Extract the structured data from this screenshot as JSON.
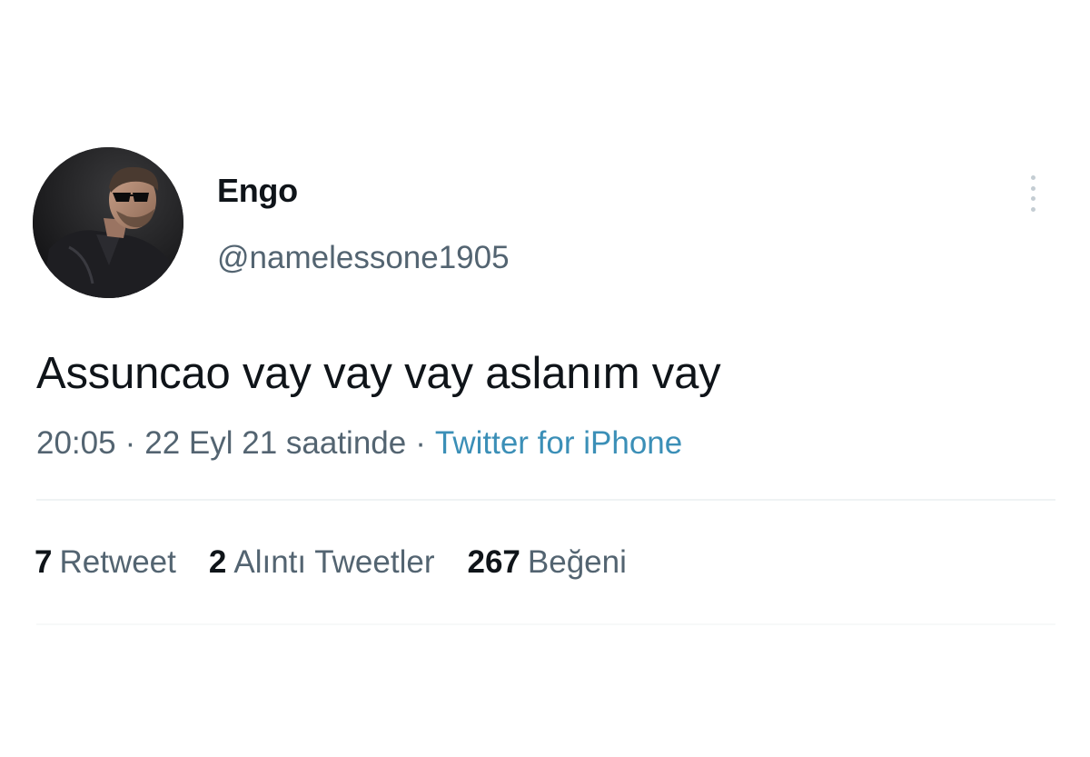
{
  "author": {
    "display_name": "Engo",
    "handle": "@namelessone1905"
  },
  "tweet": {
    "text": "Assuncao vay vay vay aslanım vay",
    "time": "20:05",
    "date": "22 Eyl 21 saatinde",
    "separator": "·",
    "source": "Twitter for iPhone"
  },
  "stats": {
    "retweets": {
      "count": "7",
      "label": "Retweet"
    },
    "quotes": {
      "count": "2",
      "label": "Alıntı Tweetler"
    },
    "likes": {
      "count": "267",
      "label": "Beğeni"
    }
  },
  "colors": {
    "text_primary": "#0f1419",
    "text_secondary": "#536471",
    "link": "#3b8fb7",
    "divider": "#eff3f4"
  },
  "icons": {
    "more": "more-vertical-icon",
    "avatar": "avatar-photo"
  }
}
